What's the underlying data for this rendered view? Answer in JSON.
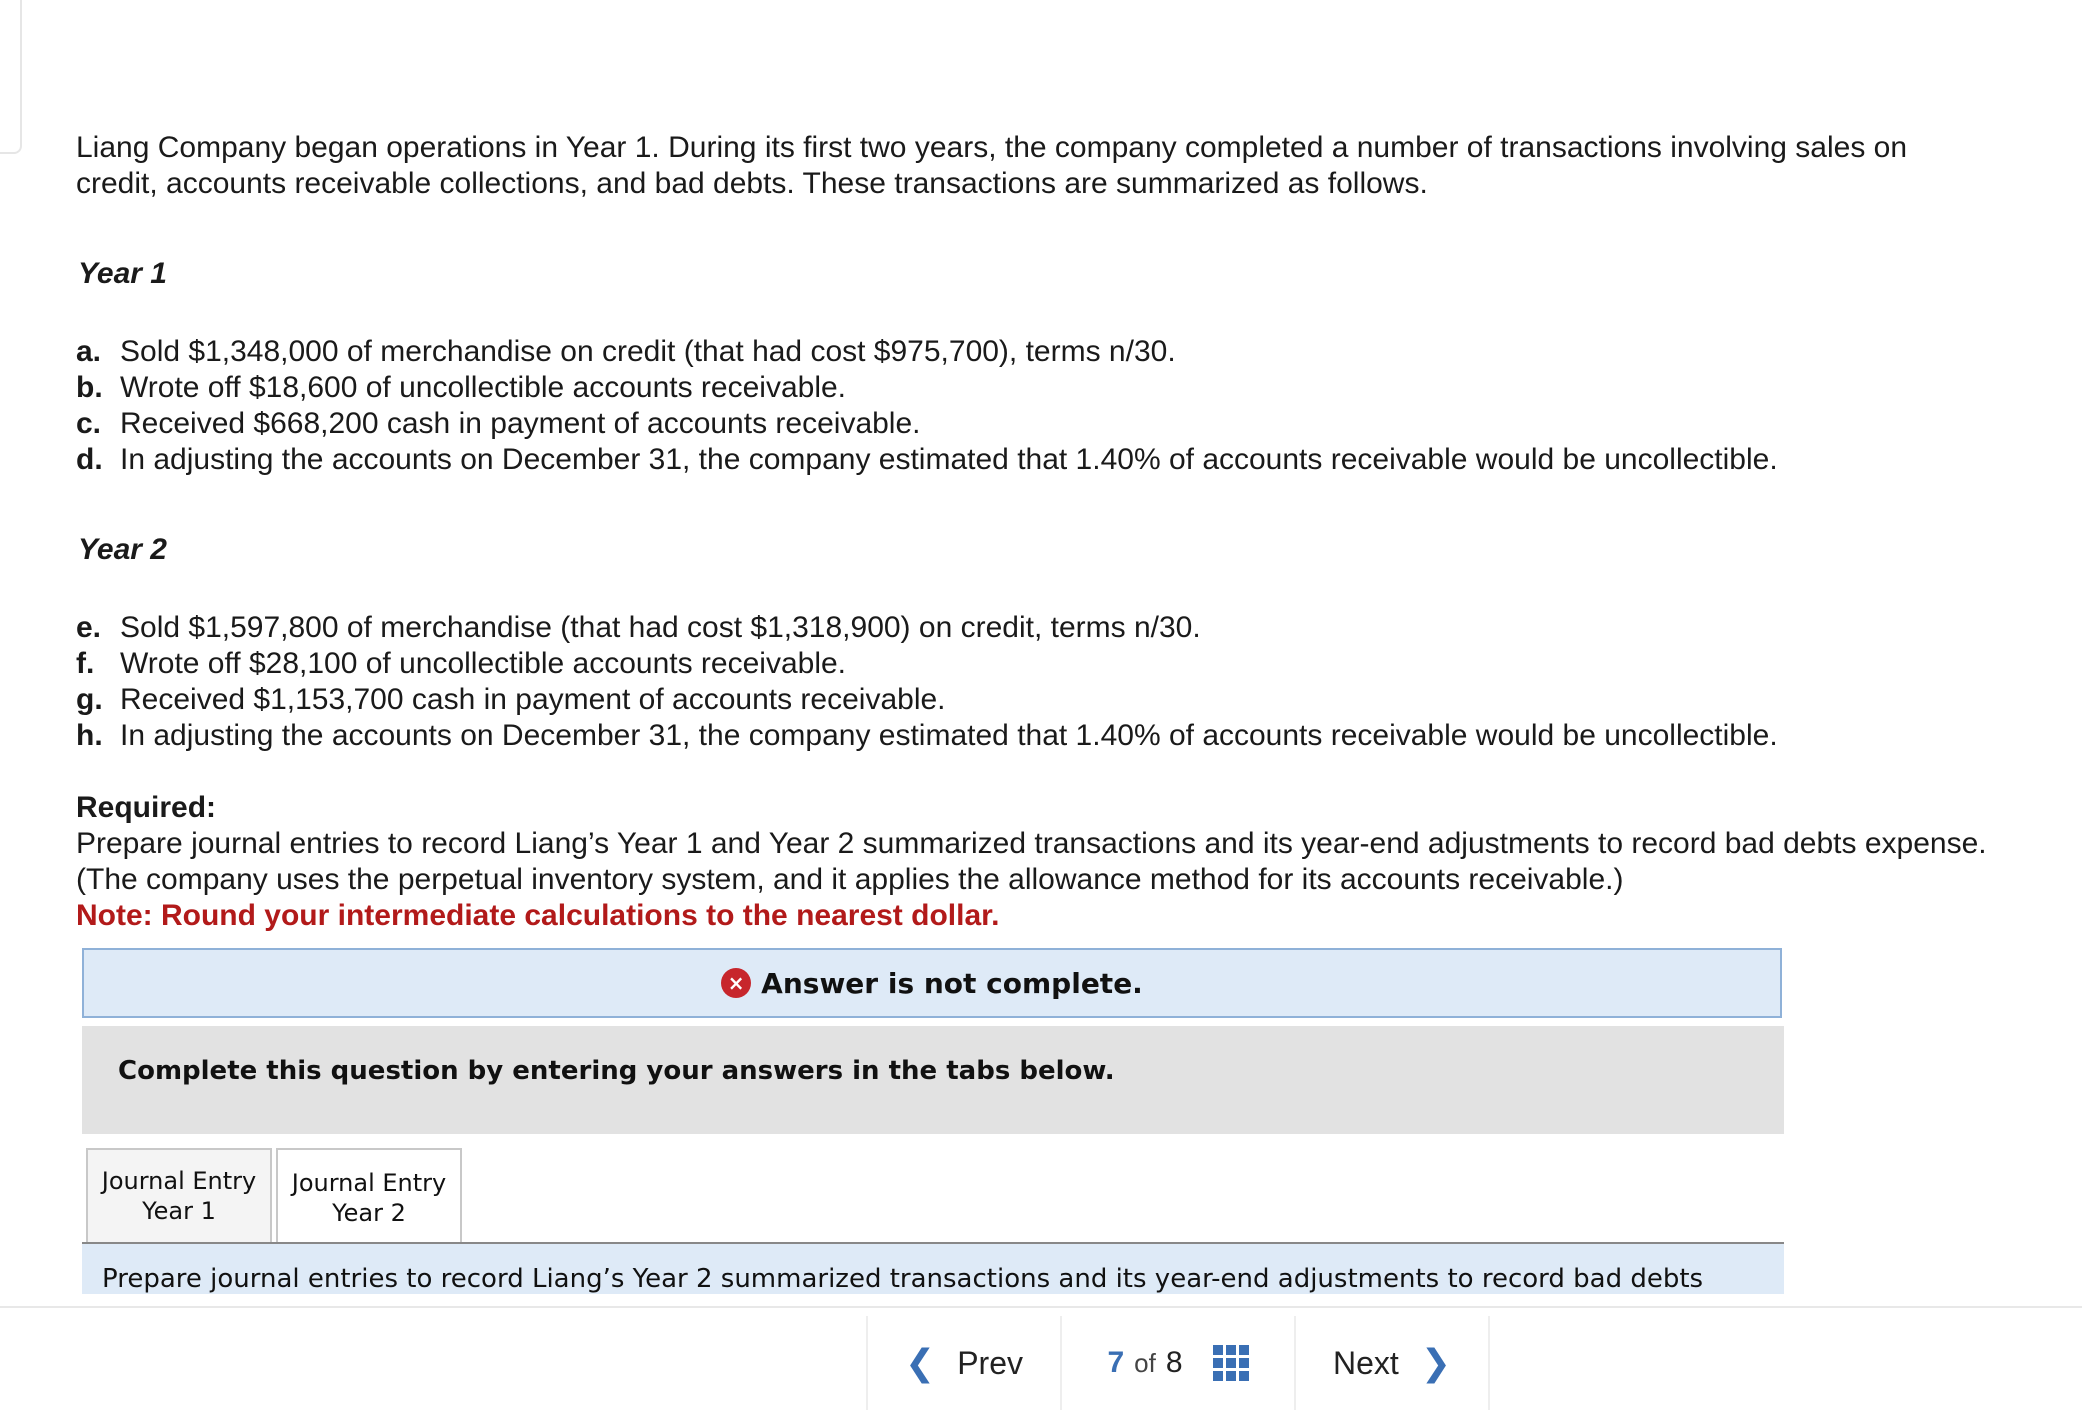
{
  "problem": {
    "intro": "Liang Company began operations in Year 1. During its first two years, the company completed a number of transactions involving sales on credit, accounts receivable collections, and bad debts. These transactions are summarized as follows.",
    "year1_heading": "Year 1",
    "year1_items": [
      {
        "letter": "a.",
        "text": "Sold $1,348,000 of merchandise on credit (that had cost $975,700), terms n/30."
      },
      {
        "letter": "b.",
        "text": "Wrote off $18,600 of uncollectible accounts receivable."
      },
      {
        "letter": "c.",
        "text": "Received $668,200 cash in payment of accounts receivable."
      },
      {
        "letter": "d.",
        "text": "In adjusting the accounts on December 31, the company estimated that 1.40% of accounts receivable would be uncollectible."
      }
    ],
    "year2_heading": "Year 2",
    "year2_items": [
      {
        "letter": "e.",
        "text": "Sold $1,597,800 of merchandise (that had cost $1,318,900) on credit, terms n/30."
      },
      {
        "letter": "f.",
        "text": "Wrote off $28,100 of uncollectible accounts receivable."
      },
      {
        "letter": "g.",
        "text": "Received $1,153,700 cash in payment of accounts receivable."
      },
      {
        "letter": "h.",
        "text": "In adjusting the accounts on December 31, the company estimated that 1.40% of accounts receivable would be uncollectible."
      }
    ],
    "required_title": "Required:",
    "required_text": "Prepare journal entries to record Liang’s Year 1 and Year 2 summarized transactions and its year-end adjustments to record bad debts expense. (The company uses the perpetual inventory system, and it applies the allowance method for its accounts receivable.)",
    "note": "Note: Round your intermediate calculations to the nearest dollar."
  },
  "answer_status": {
    "icon": "×",
    "text": "Answer is not complete."
  },
  "instructions": "Complete this question by entering your answers in the tabs below.",
  "tabs": [
    {
      "line1": "Journal Entry",
      "line2": "Year 1",
      "active": false
    },
    {
      "line1": "Journal Entry",
      "line2": "Year 2",
      "active": true
    }
  ],
  "tab_panel_text": "Prepare journal entries to record Liang’s Year 2 summarized transactions and its year-end adjustments to record bad debts",
  "footer": {
    "prev_label": "Prev",
    "current_page": "7",
    "of_label": "of",
    "total_pages": "8",
    "next_label": "Next",
    "accent_color": "#3a6fb4"
  }
}
